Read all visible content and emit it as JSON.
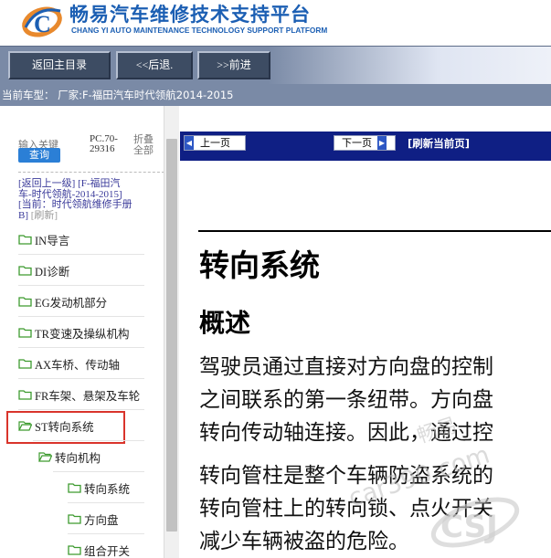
{
  "header": {
    "title": "畅易汽车维修技术支持平台",
    "subtitle": "CHANG YI AUTO MAINTENANCE TECHNOLOGY SUPPORT PLATFORM",
    "logo_letter": "C"
  },
  "toolbar": {
    "home_label": "返回主目录",
    "back_label": "<<后退.",
    "forward_label": ">>前进"
  },
  "vehicle_bar": {
    "text": "当前车型： 厂家:F-福田汽车时代领航2014-2015"
  },
  "sidebar": {
    "search_placeholder": "输入关键",
    "query_label": "查询",
    "pc_code_line1": "PC.70-",
    "pc_code_line2": "29316",
    "collapse_line1": "折叠",
    "collapse_line2": "全部",
    "breadcrumb_link1": "[返回上一级]",
    "breadcrumb_link1b": "[F-福田汽",
    "breadcrumb_link2": "车-时代领航-2014-2015]",
    "breadcrumb_link3": "[当前：时代领航维修手册",
    "breadcrumb_link4": "B]",
    "refresh_label": "[刷新]",
    "tree": [
      {
        "label": "IN导言",
        "depth": 0
      },
      {
        "label": "DI诊断",
        "depth": 0
      },
      {
        "label": "EG发动机部分",
        "depth": 0
      },
      {
        "label": "TR变速及操纵机构",
        "depth": 0
      },
      {
        "label": "AX车桥、传动轴",
        "depth": 0
      },
      {
        "label": "FR车架、悬架及车轮",
        "depth": 0
      },
      {
        "label": "ST转向系统",
        "depth": 0,
        "selected": true
      },
      {
        "label": "转向机构",
        "depth": 1
      },
      {
        "label": "转向系统",
        "depth": 2
      },
      {
        "label": "方向盘",
        "depth": 2
      },
      {
        "label": "组合开关",
        "depth": 2
      }
    ]
  },
  "content": {
    "prev_label": "上一页",
    "next_label": "下一页",
    "refresh_label": "[刷新当前页]",
    "title": "转向系统",
    "heading": "概述",
    "lines": [
      "驾驶员通过直接对方向盘的控制",
      "之间联系的第一条纽带。方向盘",
      "转向传动轴连接。因此，通过控",
      "转向管柱是整个车辆防盗系统的",
      "转向管柱上的转向锁、点火开关",
      "减少车辆被盗的危险。"
    ]
  },
  "watermark": {
    "text1": "畅易",
    "text2": "car390.com",
    "logo_text": "CSJ"
  },
  "colors": {
    "brand_blue": "#1c5fb3",
    "nav_bg": "#7a8aa6",
    "content_bar": "#0f1f84",
    "query_button": "#2b7fd6",
    "selection_border": "#d9342b",
    "folder_green": "#3d9b2f"
  }
}
